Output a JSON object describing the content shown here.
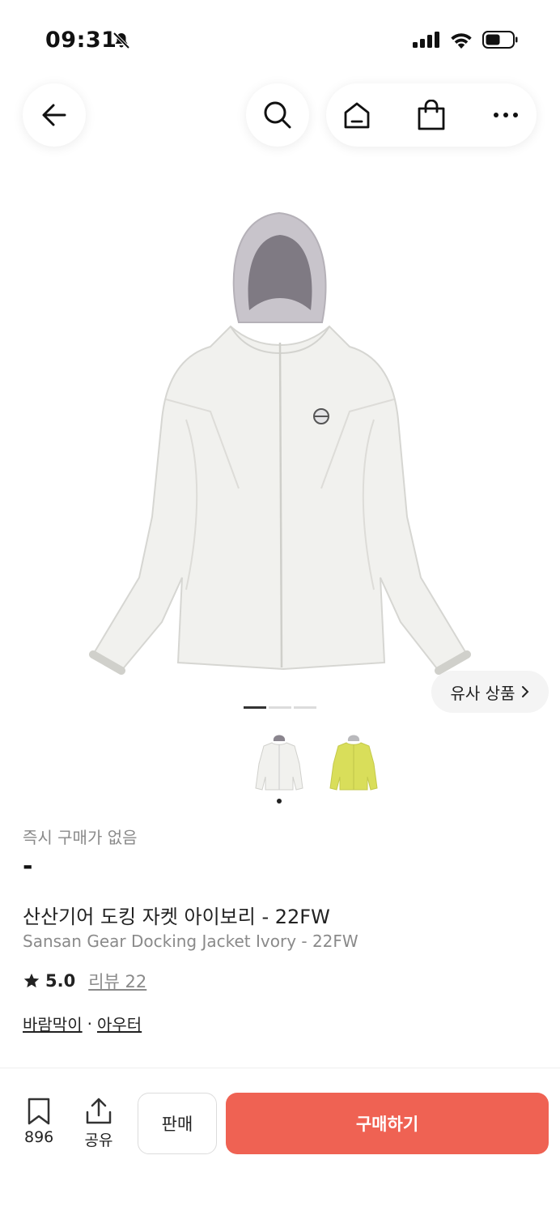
{
  "status_bar": {
    "time": "09:31"
  },
  "header": {
    "back_icon": "arrow-left-icon",
    "search_icon": "search-icon",
    "home_icon": "home-icon",
    "shop_icon": "shopping-bag-icon",
    "more_icon": "more-dots-icon"
  },
  "gallery": {
    "similar_label": "유사 상품",
    "slide_count": 3,
    "active_slide": 1,
    "thumbnails": [
      {
        "color": "ivory",
        "selected": true
      },
      {
        "color": "yellow",
        "selected": false
      }
    ]
  },
  "product": {
    "instant_buy_label": "즉시 구매가 없음",
    "price": "-",
    "title_ko": "산산기어 도킹 자켓 아이보리 - 22FW",
    "title_en": "Sansan Gear Docking Jacket Ivory - 22FW",
    "rating": "5.0",
    "review_label": "리뷰 22",
    "category_1": "바람막이",
    "category_sep": "·",
    "category_2": "아우터"
  },
  "bottom_bar": {
    "bookmark_count": "896",
    "share_label": "공유",
    "sell_label": "판매",
    "buy_label": "구매하기"
  },
  "colors": {
    "accent": "#ef6253",
    "jacket": "#f1f1ee",
    "hood_lining": "#8e8a90",
    "alt_jacket": "#d9de5a"
  }
}
